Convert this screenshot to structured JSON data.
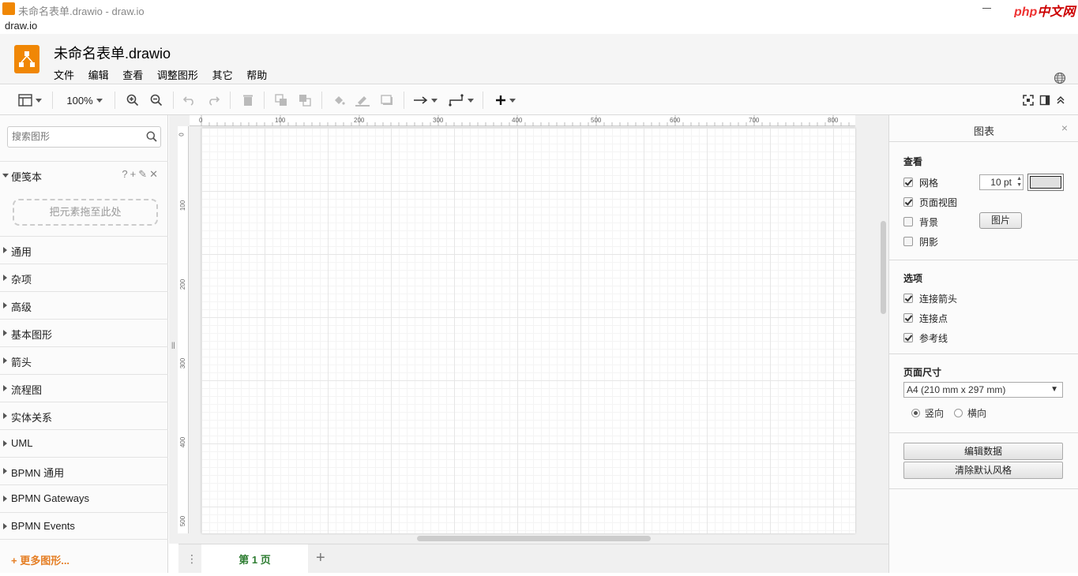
{
  "window": {
    "title": "未命名表单.drawio - draw.io",
    "watermark_a": "php",
    "watermark_b": "中文网"
  },
  "browser": {
    "label": "draw.io"
  },
  "header": {
    "doc_title": "未命名表单.drawio",
    "menus": [
      "文件",
      "编辑",
      "查看",
      "调整图形",
      "其它",
      "帮助"
    ]
  },
  "toolbar": {
    "zoom": "100%"
  },
  "sidebar": {
    "search_placeholder": "搜索图形",
    "scratchpad": {
      "label": "便笺本",
      "help": "?",
      "add": "+",
      "dropzone": "把元素拖至此处"
    },
    "sections": [
      "通用",
      "杂项",
      "高级",
      "基本图形",
      "箭头",
      "流程图",
      "实体关系",
      "UML",
      "BPMN 通用",
      "BPMN Gateways",
      "BPMN Events"
    ],
    "more_shapes": "+ 更多图形..."
  },
  "ruler": {
    "h_ticks": [
      "0",
      "100",
      "200",
      "300",
      "400",
      "500",
      "600",
      "700",
      "800"
    ],
    "v_ticks": [
      "0",
      "100",
      "200",
      "300",
      "400",
      "500"
    ]
  },
  "pages": {
    "current_tab": "第 1 页",
    "add": "+"
  },
  "format_panel": {
    "title": "图表",
    "close": "×",
    "view": {
      "title": "查看",
      "grid_label": "网格",
      "grid_checked": true,
      "grid_size": "10 pt",
      "page_view_label": "页面视图",
      "page_view_checked": true,
      "background_label": "背景",
      "background_checked": false,
      "image_button": "图片",
      "shadow_label": "阴影",
      "shadow_checked": false
    },
    "options": {
      "title": "选项",
      "connection_arrows": "连接箭头",
      "connection_points": "连接点",
      "guides": "参考线"
    },
    "paper": {
      "title": "页面尺寸",
      "size": "A4 (210 mm x 297 mm)",
      "portrait": "竖向",
      "landscape": "横向",
      "orientation": "portrait"
    },
    "buttons": {
      "edit_data": "编辑数据",
      "clear_default_style": "清除默认风格"
    }
  },
  "colors": {
    "accent": "#f08705",
    "page_tab_text": "#2e7d32",
    "more_shapes": "#e57e24"
  }
}
